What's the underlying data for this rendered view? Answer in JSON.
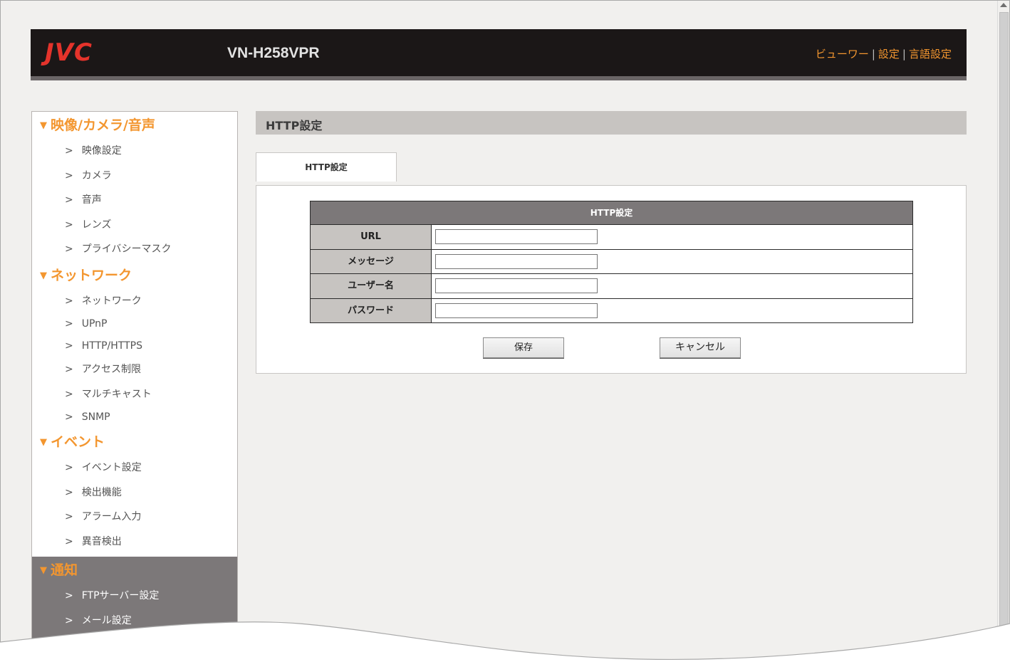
{
  "header": {
    "logo": "JVC",
    "model": "VN-H258VPR",
    "links": [
      "ビューワー",
      "設定",
      "言語設定"
    ]
  },
  "sidebar": {
    "sections": [
      {
        "title": "映像/カメラ/音声",
        "items": [
          "映像設定",
          "カメラ",
          "音声",
          "レンズ",
          "プライバシーマスク"
        ]
      },
      {
        "title": "ネットワーク",
        "items": [
          "ネットワーク",
          "UPnP",
          "HTTP/HTTPS",
          "アクセス制限",
          "マルチキャスト",
          "SNMP"
        ]
      },
      {
        "title": "イベント",
        "items": [
          "イベント設定",
          "検出機能",
          "アラーム入力",
          "異音検出"
        ]
      },
      {
        "title": "通知",
        "items": [
          "FTPサーバー設定",
          "メール設定"
        ]
      }
    ],
    "item_prefix": ">",
    "section_marker": "▼"
  },
  "main": {
    "title": "HTTP設定",
    "tab_label": "HTTP設定",
    "table": {
      "header": "HTTP設定",
      "rows": [
        {
          "label": "URL",
          "value": ""
        },
        {
          "label": "メッセージ",
          "value": ""
        },
        {
          "label": "ユーザー名",
          "value": ""
        },
        {
          "label": "パスワード",
          "value": ""
        }
      ]
    },
    "buttons": {
      "save": "保存",
      "cancel": "キャンセル"
    }
  },
  "colors": {
    "accent": "#f3962f",
    "header_bg": "#1b1717",
    "logo_red": "#e4332b",
    "active_section_bg": "#7c7879",
    "title_bar_bg": "#c7c4c1"
  }
}
